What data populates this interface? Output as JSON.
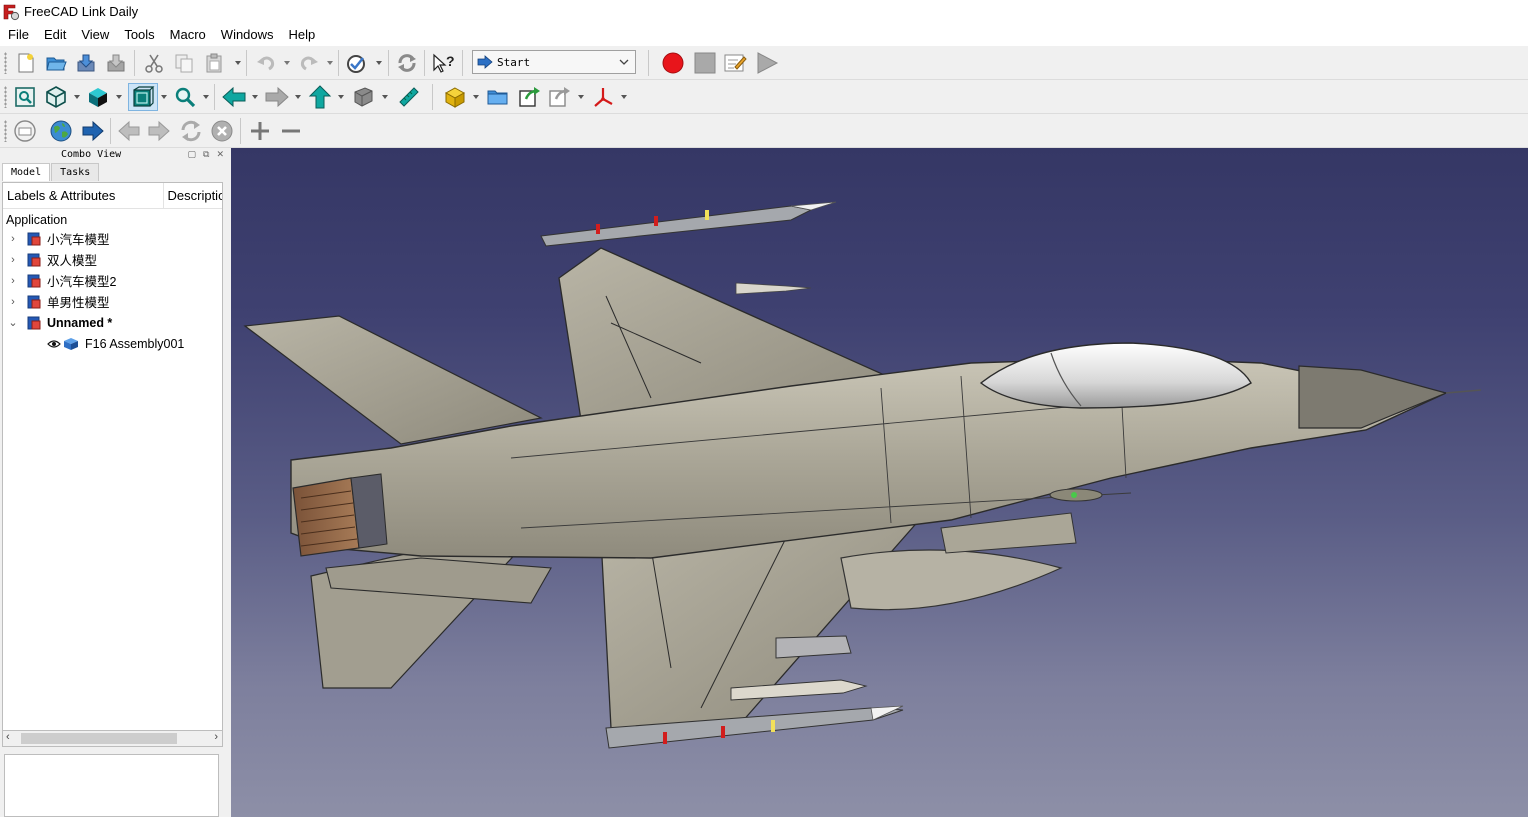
{
  "window": {
    "title": "FreeCAD Link Daily"
  },
  "menu": [
    "File",
    "Edit",
    "View",
    "Tools",
    "Macro",
    "Windows",
    "Help"
  ],
  "workbench": {
    "selected": "Start"
  },
  "combo_view": {
    "title": "Combo View",
    "tabs": [
      "Model",
      "Tasks"
    ],
    "tree_header": {
      "col1": "Labels & Attributes",
      "col2": "Description"
    },
    "root_label": "Application",
    "documents": [
      {
        "label": "小汽车模型",
        "expanded": false
      },
      {
        "label": "双人模型",
        "expanded": false
      },
      {
        "label": "小汽车模型2",
        "expanded": false
      },
      {
        "label": "单男性模型",
        "expanded": false
      },
      {
        "label": "Unnamed *",
        "expanded": true,
        "active": true
      }
    ],
    "objects": [
      {
        "label": "F16 Assembly001",
        "visible": true
      }
    ]
  },
  "colors": {
    "viewport_top": "#353765",
    "viewport_bottom": "#8d8fa7",
    "macro_record": "#e8151b",
    "aircraft_body": "#a8a496"
  },
  "icons": {
    "toolbar1": [
      "new-document-icon",
      "open-icon",
      "save-icon",
      "save-as-icon",
      "cut-icon",
      "copy-icon",
      "paste-icon",
      "undo-icon",
      "redo-icon",
      "refresh-check-icon",
      "recompute-icon",
      "whats-this-icon",
      "macro-record-icon",
      "macro-stop-icon",
      "macro-edit-icon",
      "macro-run-icon"
    ],
    "toolbar2": [
      "fit-all-icon",
      "isometric-view-icon",
      "draw-style-icon",
      "bounding-box-icon",
      "zoom-icon",
      "back-nav-icon",
      "forward-nav-icon",
      "up-nav-icon",
      "box-selection-icon",
      "measure-icon",
      "part-icon",
      "folder-icon",
      "link-icon",
      "link-import-icon",
      "axis-cross-icon"
    ],
    "toolbar3": [
      "web-home-icon",
      "web-globe-icon",
      "web-go-icon",
      "web-back-icon",
      "web-forward-icon",
      "web-refresh-icon",
      "web-stop-icon",
      "web-zoom-in-icon",
      "web-zoom-out-icon"
    ]
  }
}
